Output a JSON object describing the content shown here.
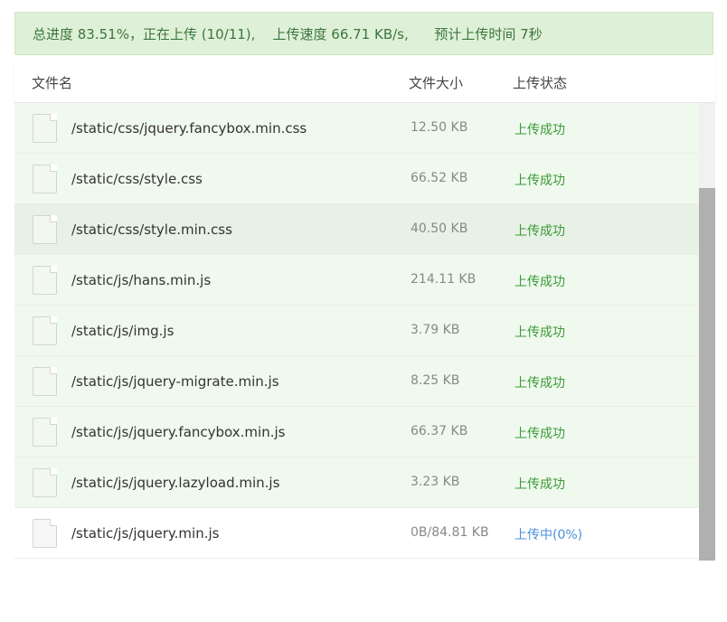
{
  "summary": {
    "text": "总进度 83.51%，正在上传 (10/11),    上传速度 66.71 KB/s,      预计上传时间 7秒"
  },
  "header": {
    "name": "文件名",
    "size": "文件大小",
    "status": "上传状态"
  },
  "files": [
    {
      "name": "/static/css/jquery.fancybox.min.css",
      "size": "12.50 KB",
      "status": "上传成功"
    },
    {
      "name": "/static/css/style.css",
      "size": "66.52 KB",
      "status": "上传成功"
    },
    {
      "name": "/static/css/style.min.css",
      "size": "40.50 KB",
      "status": "上传成功"
    },
    {
      "name": "/static/js/hans.min.js",
      "size": "214.11 KB",
      "status": "上传成功"
    },
    {
      "name": "/static/js/img.js",
      "size": "3.79 KB",
      "status": "上传成功"
    },
    {
      "name": "/static/js/jquery-migrate.min.js",
      "size": "8.25 KB",
      "status": "上传成功"
    },
    {
      "name": "/static/js/jquery.fancybox.min.js",
      "size": "66.37 KB",
      "status": "上传成功"
    },
    {
      "name": "/static/js/jquery.lazyload.min.js",
      "size": "3.23 KB",
      "status": "上传成功"
    },
    {
      "name": "/static/js/jquery.min.js",
      "size": "0B/84.81 KB",
      "status": "上传中(0%)"
    }
  ],
  "icons": {
    "file": "file-icon"
  },
  "colors": {
    "success": "#3a9a3a",
    "uploading": "#4a90d9",
    "summary_bg": "#dff0d8"
  }
}
